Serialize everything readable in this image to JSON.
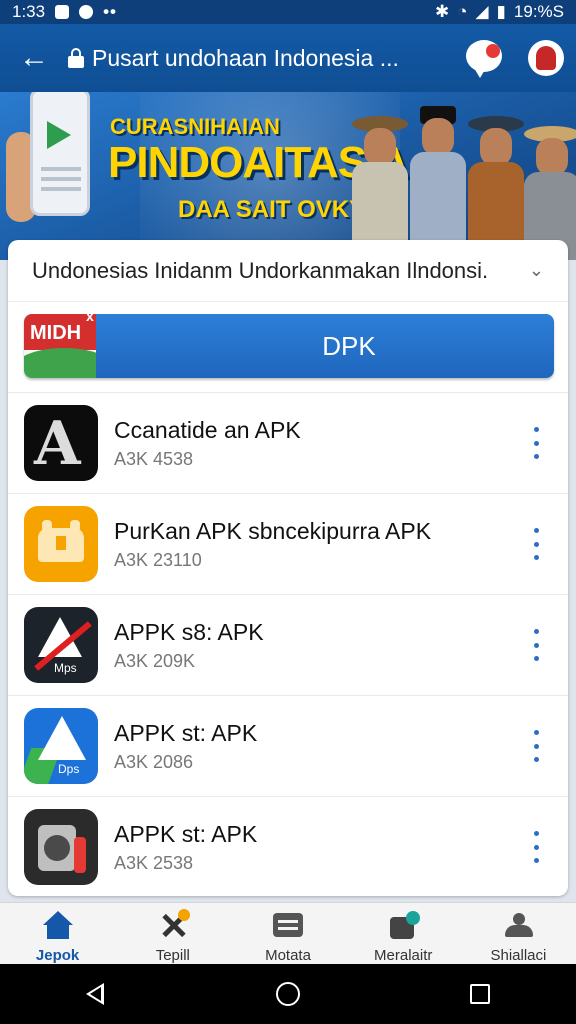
{
  "status_bar": {
    "time": "1:33",
    "battery": "19:%S"
  },
  "app_bar": {
    "title": "Pusart undohaan Indonesia ..."
  },
  "banner": {
    "line1": "CURASNIHAIAN",
    "line2": "PINDOAITASIA",
    "line3": "DAA SAIT OVKY"
  },
  "dropdown": {
    "value": "Undonesias Inidanm Undorkanmakan Ilndonsi."
  },
  "dpk": {
    "badge": "MIDH",
    "label": "DPK"
  },
  "apps": [
    {
      "name": "Ccanatide an APK",
      "size": "A3K 4538",
      "icon": "letter-a-icon"
    },
    {
      "name": "PurKan APK sbncekipurra APK",
      "size": "A3K 23110",
      "icon": "android-icon"
    },
    {
      "name": "APPK s8: APK",
      "size": "A3K 209K",
      "icon": "triangle-slash-icon"
    },
    {
      "name": "APPK st: APK",
      "size": "A3K 2086",
      "icon": "triangle-blue-icon"
    },
    {
      "name": "APPK st: APK",
      "size": "A3K 2538",
      "icon": "device-icon"
    }
  ],
  "bottom_nav": [
    {
      "label": "Jepok",
      "icon": "home-icon",
      "active": true
    },
    {
      "label": "Tepill",
      "icon": "tools-icon",
      "active": false
    },
    {
      "label": "Motata",
      "icon": "grid-icon",
      "active": false
    },
    {
      "label": "Meralaitr",
      "icon": "market-icon",
      "active": false
    },
    {
      "label": "Shiallaci",
      "icon": "people-icon",
      "active": false
    }
  ],
  "colors": {
    "primary": "#135aa6",
    "accent": "#ffd400",
    "button": "#2d7fd8"
  }
}
